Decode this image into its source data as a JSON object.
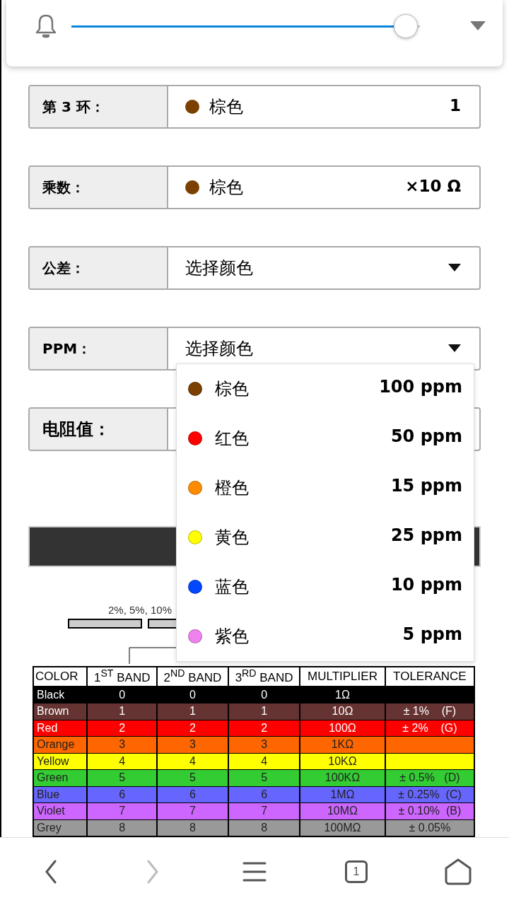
{
  "volume_panel": {
    "level": 0.96
  },
  "form_rows": [
    {
      "label": "第 3 环：",
      "kind": "chosen",
      "color": "#7b3f00",
      "value": "棕色",
      "reading": "1"
    },
    {
      "label": "乘数：",
      "kind": "chosen",
      "color": "#7b3f00",
      "value": "棕色",
      "reading": "×10 Ω"
    },
    {
      "label": "公差：",
      "kind": "select",
      "placeholder": "选择颜色"
    },
    {
      "label": "PPM：",
      "kind": "select",
      "placeholder": "选择颜色"
    },
    {
      "label": "电阻值：",
      "kind": "result"
    }
  ],
  "ppm_dropdown": {
    "items": [
      {
        "name": "棕色",
        "color": "#7b3f00",
        "value": "100 ppm",
        "selected": false
      },
      {
        "name": "红色",
        "color": "#ff0000",
        "value": "50 ppm",
        "selected": false
      },
      {
        "name": "橙色",
        "color": "#ff8c00",
        "value": "15 ppm",
        "selected": false
      },
      {
        "name": "黄色",
        "color": "#ffff00",
        "value": "25 ppm",
        "selected": false
      },
      {
        "name": "蓝色",
        "color": "#0047ff",
        "value": "10 ppm",
        "selected": false
      },
      {
        "name": "紫色",
        "color": "#ee82ee",
        "value": "5 ppm",
        "selected": false
      }
    ]
  },
  "diagram": {
    "caption": "2%, 5%, 10%"
  },
  "color_table": {
    "columns": [
      "COLOR",
      "1$^{ST}$ BAND",
      "2$^{ND}$ BAND",
      "3$^{RD}$ BAND",
      "MULTIPLIER",
      "TOLERANCE"
    ],
    "rows": [
      {
        "color": "#000000",
        "cells": [
          "Black",
          "0",
          "0",
          "0",
          "1Ω"
        ]
      },
      {
        "color": "#663333",
        "cells": [
          "Brown",
          "1",
          "1",
          "1",
          "10Ω",
          "± 1%    (F)"
        ]
      },
      {
        "color": "#ff0000",
        "cells": [
          "Red",
          "2",
          "2",
          "2",
          "100Ω",
          "± 2%    (G)"
        ]
      },
      {
        "color": "#ff6600",
        "cells": [
          "Orange",
          "3",
          "3",
          "3",
          "1KΩ"
        ]
      },
      {
        "color": "#ffff00",
        "cells": [
          "Yellow",
          "4",
          "4",
          "4",
          "10KΩ"
        ]
      },
      {
        "color": "#33cc33",
        "cells": [
          "Green",
          "5",
          "5",
          "5",
          "100KΩ",
          "± 0.5%   (D)"
        ]
      },
      {
        "color": "#6666ff",
        "cells": [
          "Blue",
          "6",
          "6",
          "6",
          "1MΩ",
          "± 0.25%  (C)"
        ]
      },
      {
        "color": "#cc66ff",
        "cells": [
          "Violet",
          "7",
          "7",
          "7",
          "10MΩ",
          "± 0.10%  (B)"
        ]
      },
      {
        "color": "#999999",
        "cells": [
          "Grey",
          "8",
          "8",
          "8",
          "100MΩ",
          "± 0.05%"
        ]
      }
    ]
  },
  "bottom_nav": {
    "back_disabled": false,
    "forward_disabled": true,
    "tab_count": "1"
  }
}
